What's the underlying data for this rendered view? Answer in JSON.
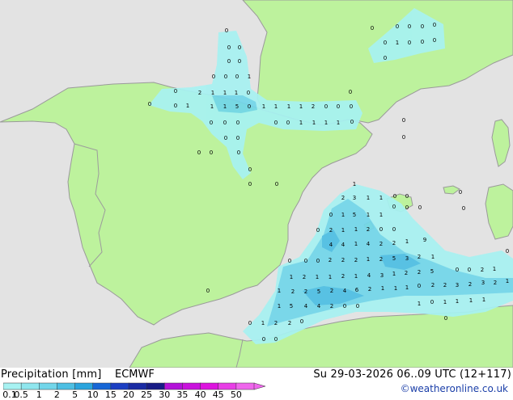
{
  "legend": {
    "title": "Precipitation [mm]",
    "model": "ECMWF",
    "ticks": [
      "0.1",
      "0.5",
      "1",
      "2",
      "5",
      "10",
      "15",
      "20",
      "25",
      "30",
      "35",
      "40",
      "45",
      "50"
    ],
    "colors": [
      "#a7f2f2",
      "#8fe6ee",
      "#72d6ea",
      "#4dbfe3",
      "#2aa4dd",
      "#1666d6",
      "#1c3fc3",
      "#1a2ba4",
      "#181c86",
      "#b312d9",
      "#c912dd",
      "#dd14df",
      "#e83ee6",
      "#ef66ec"
    ]
  },
  "valid_time": "Su 29-03-2026 06..09 UTC (12+117)",
  "credit": "©weatheronline.co.uk",
  "map": {
    "colors": {
      "sea": "#e3e3e3",
      "land": "#bdf29d",
      "coast": "#9a9a9a",
      "border": "#9c9c9c",
      "precip_light": "#a7f2f2",
      "precip_mid": "#72d6ea",
      "precip_heavy": "#4dbfe3"
    },
    "values": [
      [
        "0",
        280,
        40
      ],
      [
        "0",
        283,
        61
      ],
      [
        "0",
        296,
        61
      ],
      [
        "0",
        283,
        78
      ],
      [
        "0",
        296,
        78
      ],
      [
        "0",
        264,
        97
      ],
      [
        "0",
        279,
        97
      ],
      [
        "0",
        293,
        97
      ],
      [
        "1",
        308,
        97
      ],
      [
        "0",
        217,
        115
      ],
      [
        "2",
        247,
        117
      ],
      [
        "1",
        263,
        117
      ],
      [
        "1",
        278,
        117
      ],
      [
        "1",
        292,
        117
      ],
      [
        "0",
        307,
        117
      ],
      [
        "0",
        185,
        131
      ],
      [
        "0",
        217,
        133
      ],
      [
        "1",
        232,
        133
      ],
      [
        "1",
        262,
        134
      ],
      [
        "1",
        278,
        134
      ],
      [
        "5",
        293,
        134
      ],
      [
        "0",
        308,
        134
      ],
      [
        "1",
        326,
        134
      ],
      [
        "1",
        341,
        134
      ],
      [
        "1",
        357,
        134
      ],
      [
        "1",
        372,
        134
      ],
      [
        "2",
        387,
        134
      ],
      [
        "0",
        403,
        134
      ],
      [
        "0",
        418,
        134
      ],
      [
        "0",
        434,
        134
      ],
      [
        "0",
        433,
        116
      ],
      [
        "0",
        261,
        154
      ],
      [
        "0",
        278,
        154
      ],
      [
        "0",
        294,
        154
      ],
      [
        "0",
        341,
        154
      ],
      [
        "0",
        356,
        154
      ],
      [
        "1",
        372,
        154
      ],
      [
        "1",
        388,
        154
      ],
      [
        "1",
        403,
        154
      ],
      [
        "1",
        418,
        154
      ],
      [
        "0",
        435,
        153
      ],
      [
        "0",
        499,
        151
      ],
      [
        "0",
        279,
        173
      ],
      [
        "0",
        294,
        173
      ],
      [
        "0",
        499,
        172
      ],
      [
        "0",
        246,
        191
      ],
      [
        "0",
        261,
        191
      ],
      [
        "0",
        295,
        191
      ],
      [
        "0",
        309,
        212
      ],
      [
        "0",
        309,
        230
      ],
      [
        "0",
        342,
        230
      ],
      [
        "0",
        460,
        37
      ],
      [
        "0",
        491,
        35
      ],
      [
        "0",
        506,
        35
      ],
      [
        "0",
        522,
        35
      ],
      [
        "0",
        537,
        33
      ],
      [
        "0",
        476,
        55
      ],
      [
        "1",
        491,
        55
      ],
      [
        "0",
        506,
        55
      ],
      [
        "0",
        522,
        54
      ],
      [
        "0",
        537,
        52
      ],
      [
        "0",
        476,
        74
      ],
      [
        "0",
        569,
        240
      ],
      [
        "1",
        438,
        230
      ],
      [
        "2",
        424,
        247
      ],
      [
        "3",
        438,
        247
      ],
      [
        "1",
        455,
        247
      ],
      [
        "1",
        471,
        247
      ],
      [
        "0",
        488,
        245
      ],
      [
        "0",
        503,
        245
      ],
      [
        "0",
        409,
        268
      ],
      [
        "1",
        424,
        268
      ],
      [
        "5",
        438,
        268
      ],
      [
        "1",
        455,
        268
      ],
      [
        "1",
        471,
        268
      ],
      [
        "0",
        487,
        258
      ],
      [
        "0",
        503,
        259
      ],
      [
        "0",
        519,
        259
      ],
      [
        "0",
        573,
        260
      ],
      [
        "0",
        393,
        287
      ],
      [
        "2",
        409,
        287
      ],
      [
        "1",
        424,
        287
      ],
      [
        "1",
        440,
        286
      ],
      [
        "2",
        455,
        286
      ],
      [
        "0",
        471,
        286
      ],
      [
        "0",
        487,
        286
      ],
      [
        "4",
        409,
        305
      ],
      [
        "4",
        424,
        305
      ],
      [
        "1",
        440,
        304
      ],
      [
        "4",
        455,
        304
      ],
      [
        "2",
        471,
        304
      ],
      [
        "2",
        487,
        303
      ],
      [
        "1",
        503,
        301
      ],
      [
        "9",
        525,
        299
      ],
      [
        "0",
        358,
        325
      ],
      [
        "0",
        378,
        325
      ],
      [
        "0",
        393,
        325
      ],
      [
        "2",
        408,
        324
      ],
      [
        "2",
        424,
        324
      ],
      [
        "2",
        440,
        324
      ],
      [
        "1",
        455,
        323
      ],
      [
        "2",
        471,
        323
      ],
      [
        "5",
        487,
        322
      ],
      [
        "3",
        503,
        322
      ],
      [
        "2",
        518,
        320
      ],
      [
        "1",
        535,
        320
      ],
      [
        "0",
        627,
        313
      ],
      [
        "1",
        360,
        345
      ],
      [
        "2",
        376,
        345
      ],
      [
        "1",
        392,
        345
      ],
      [
        "1",
        408,
        345
      ],
      [
        "2",
        424,
        344
      ],
      [
        "1",
        440,
        344
      ],
      [
        "4",
        456,
        343
      ],
      [
        "3",
        472,
        343
      ],
      [
        "1",
        487,
        341
      ],
      [
        "2",
        502,
        340
      ],
      [
        "2",
        518,
        339
      ],
      [
        "5",
        534,
        338
      ],
      [
        "0",
        565,
        336
      ],
      [
        "0",
        580,
        336
      ],
      [
        "2",
        596,
        336
      ],
      [
        "1",
        611,
        335
      ],
      [
        "1",
        345,
        362
      ],
      [
        "2",
        362,
        363
      ],
      [
        "2",
        378,
        363
      ],
      [
        "5",
        394,
        363
      ],
      [
        "2",
        410,
        362
      ],
      [
        "4",
        426,
        362
      ],
      [
        "6",
        441,
        361
      ],
      [
        "2",
        457,
        360
      ],
      [
        "1",
        473,
        359
      ],
      [
        "1",
        489,
        359
      ],
      [
        "1",
        503,
        358
      ],
      [
        "0",
        518,
        356
      ],
      [
        "2",
        535,
        355
      ],
      [
        "2",
        550,
        355
      ],
      [
        "3",
        565,
        355
      ],
      [
        "2",
        581,
        354
      ],
      [
        "3",
        597,
        352
      ],
      [
        "2",
        612,
        352
      ],
      [
        "1",
        627,
        350
      ],
      [
        "1",
        345,
        381
      ],
      [
        "5",
        360,
        381
      ],
      [
        "4",
        378,
        381
      ],
      [
        "4",
        394,
        381
      ],
      [
        "2",
        410,
        381
      ],
      [
        "0",
        426,
        381
      ],
      [
        "0",
        442,
        381
      ],
      [
        "1",
        518,
        378
      ],
      [
        "0",
        534,
        376
      ],
      [
        "1",
        550,
        376
      ],
      [
        "1",
        565,
        375
      ],
      [
        "1",
        582,
        374
      ],
      [
        "1",
        598,
        373
      ],
      [
        "0",
        309,
        402
      ],
      [
        "1",
        325,
        402
      ],
      [
        "2",
        341,
        402
      ],
      [
        "2",
        358,
        402
      ],
      [
        "0",
        373,
        400
      ],
      [
        "0",
        551,
        396
      ],
      [
        "0",
        326,
        422
      ],
      [
        "0",
        341,
        422
      ],
      [
        "0",
        257,
        362
      ]
    ]
  }
}
